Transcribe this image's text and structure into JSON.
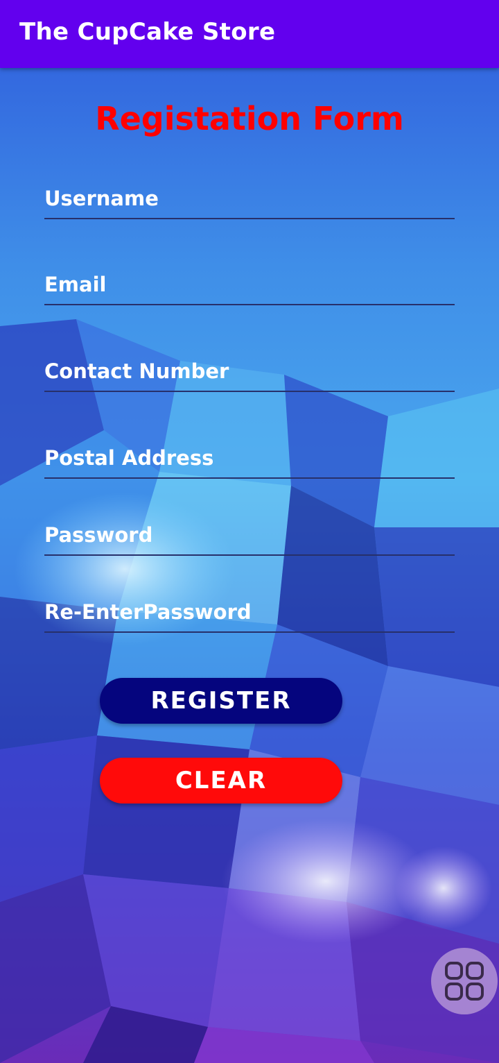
{
  "app_bar": {
    "title": "The CupCake Store",
    "color": "#6200ee"
  },
  "form": {
    "title": "Registation Form",
    "title_color": "#ff0000",
    "fields": {
      "username": {
        "placeholder": "Username",
        "value": ""
      },
      "email": {
        "placeholder": "Email",
        "value": ""
      },
      "contact_number": {
        "placeholder": "Contact Number",
        "value": ""
      },
      "postal_address": {
        "placeholder": "Postal Address",
        "value": ""
      },
      "password": {
        "placeholder": "Password",
        "value": ""
      },
      "reenter_password": {
        "placeholder": "Re-EnterPassword",
        "value": ""
      }
    },
    "buttons": {
      "register": {
        "label": "REGISTER",
        "color": "#05057e"
      },
      "clear": {
        "label": "CLEAR",
        "color": "#ff0a0a"
      }
    }
  },
  "floating_button": {
    "icon": "grid-apps-icon"
  }
}
